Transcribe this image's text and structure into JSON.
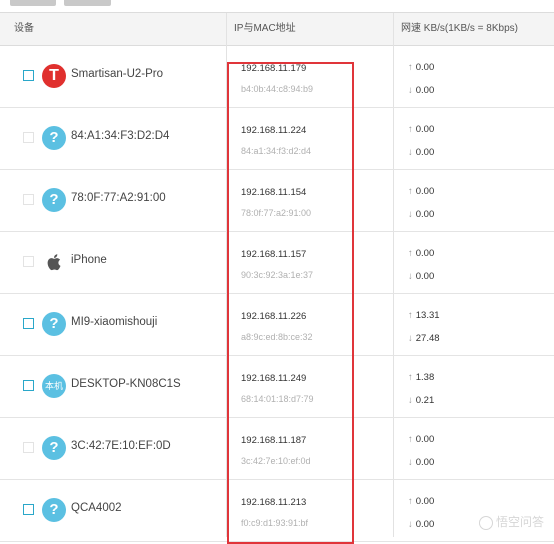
{
  "header": {
    "device": "设备",
    "ip_mac": "IP与MAC地址",
    "rate": "网速 KB/s(1KB/s = 8Kbps)"
  },
  "rows": [
    {
      "name": "Smartisan-U2-Pro",
      "icon": "smartisan-icon",
      "glyph": "T",
      "ip": "192.168.11.179",
      "mac": "b4:0b:44:c8:94:b9",
      "up": "0.00",
      "down": "0.00",
      "checked": true
    },
    {
      "name": "84:A1:34:F3:D2:D4",
      "icon": "unknown-device-icon",
      "glyph": "?",
      "ip": "192.168.11.224",
      "mac": "84:a1:34:f3:d2:d4",
      "up": "0.00",
      "down": "0.00",
      "checked": false
    },
    {
      "name": "78:0F:77:A2:91:00",
      "icon": "unknown-device-icon",
      "glyph": "?",
      "ip": "192.168.11.154",
      "mac": "78:0f:77:a2:91:00",
      "up": "0.00",
      "down": "0.00",
      "checked": false
    },
    {
      "name": "iPhone",
      "icon": "apple-icon",
      "glyph": "",
      "ip": "192.168.11.157",
      "mac": "90:3c:92:3a:1e:37",
      "up": "0.00",
      "down": "0.00",
      "checked": false
    },
    {
      "name": "MI9-xiaomishouji",
      "icon": "unknown-device-icon",
      "glyph": "?",
      "ip": "192.168.11.226",
      "mac": "a8:9c:ed:8b:ce:32",
      "up": "13.31",
      "down": "27.48",
      "checked": true
    },
    {
      "name": "DESKTOP-KN08C1S",
      "icon": "local-device-icon",
      "glyph": "本机",
      "ip": "192.168.11.249",
      "mac": "68:14:01:18:d7:79",
      "up": "1.38",
      "down": "0.21",
      "checked": true
    },
    {
      "name": "3C:42:7E:10:EF:0D",
      "icon": "unknown-device-icon",
      "glyph": "?",
      "ip": "192.168.11.187",
      "mac": "3c:42:7e:10:ef:0d",
      "up": "0.00",
      "down": "0.00",
      "checked": false
    },
    {
      "name": "QCA4002",
      "icon": "unknown-device-icon",
      "glyph": "?",
      "ip": "192.168.11.213",
      "mac": "f0:c9:d1:93:91:bf",
      "up": "0.00",
      "down": "0.00",
      "checked": true
    }
  ],
  "arrows": {
    "up": "↑",
    "down": "↓"
  },
  "watermark": "悟空问答",
  "colors": {
    "highlight_box": "#e0353a",
    "accent": "#2aa7c9",
    "unknown_icon": "#5bc0e2",
    "smartisan": "#e0302e"
  }
}
